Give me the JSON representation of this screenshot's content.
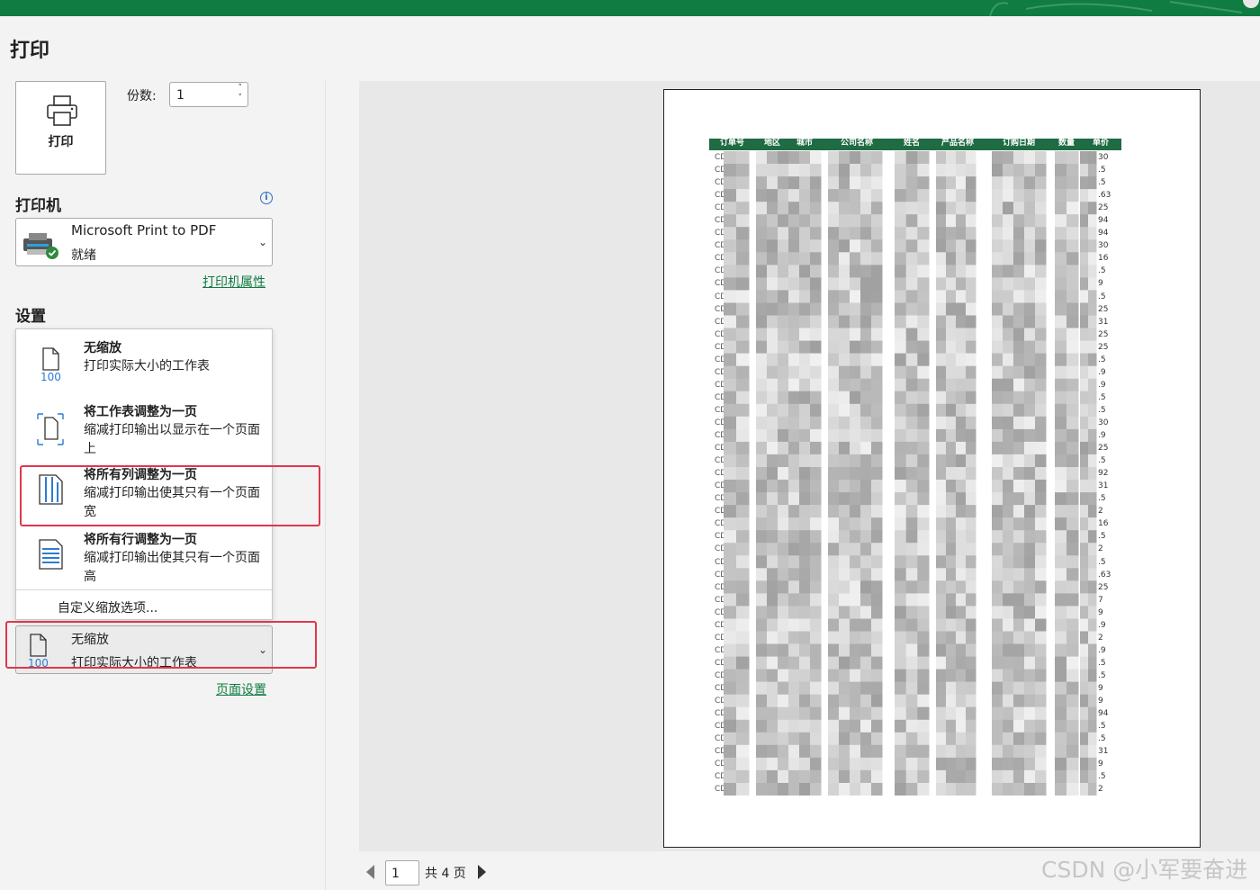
{
  "title": "打印",
  "print_button_label": "打印",
  "copies": {
    "label": "份数:",
    "value": "1"
  },
  "printer": {
    "section_label": "打印机",
    "name": "Microsoft Print to PDF",
    "status": "就绪",
    "properties_link": "打印机属性"
  },
  "settings": {
    "section_label": "设置",
    "options": [
      {
        "title": "无缩放",
        "desc": "打印实际大小的工作表",
        "icon": "no-scaling-icon"
      },
      {
        "title": "将工作表调整为一页",
        "desc": "缩减打印输出以显示在一个页面上",
        "icon": "fit-sheet-icon"
      },
      {
        "title": "将所有列调整为一页",
        "desc": "缩减打印输出使其只有一个页面宽",
        "icon": "fit-columns-icon"
      },
      {
        "title": "将所有行调整为一页",
        "desc": "缩减打印输出使其只有一个页面高",
        "icon": "fit-rows-icon"
      }
    ],
    "custom_option": "自定义缩放选项...",
    "selected": {
      "title": "无缩放",
      "desc": "打印实际大小的工作表"
    },
    "page_setup_link": "页面设置"
  },
  "preview": {
    "headers": [
      "订单号",
      "地区",
      "城市",
      "公司名称",
      "姓名",
      "产品名称",
      "订购日期",
      "数量",
      "单价"
    ],
    "first_col_prefix": "CD",
    "price_fragments": [
      "30",
      ".5",
      ".5",
      ".63",
      "25",
      "94",
      "94",
      "30",
      "16",
      ".5",
      "9",
      ".5",
      "25",
      "31",
      "25",
      "25",
      ".5",
      ".9",
      ".9",
      ".5",
      ".5",
      "30",
      ".9",
      "25",
      ".5",
      "92",
      "31",
      ".5",
      "2",
      "16",
      ".5",
      "2",
      ".5",
      ".63",
      "25",
      "7",
      "9",
      ".9",
      "2",
      ".9",
      ".5",
      ".5",
      "9",
      "9",
      "94",
      ".5",
      ".5",
      "31",
      "9",
      ".5",
      "2"
    ],
    "last_row_text": "CDJ0001  华东  青岛  鑫腾建设  刘来儿  鸭肉  2019/11/27  37",
    "accent_color": "#1f6b43"
  },
  "pager": {
    "current": "1",
    "total": "共 4 页"
  },
  "watermark": "CSDN @小军要奋进",
  "colors": {
    "brand": "#107c41",
    "highlight": "#e0374b"
  }
}
